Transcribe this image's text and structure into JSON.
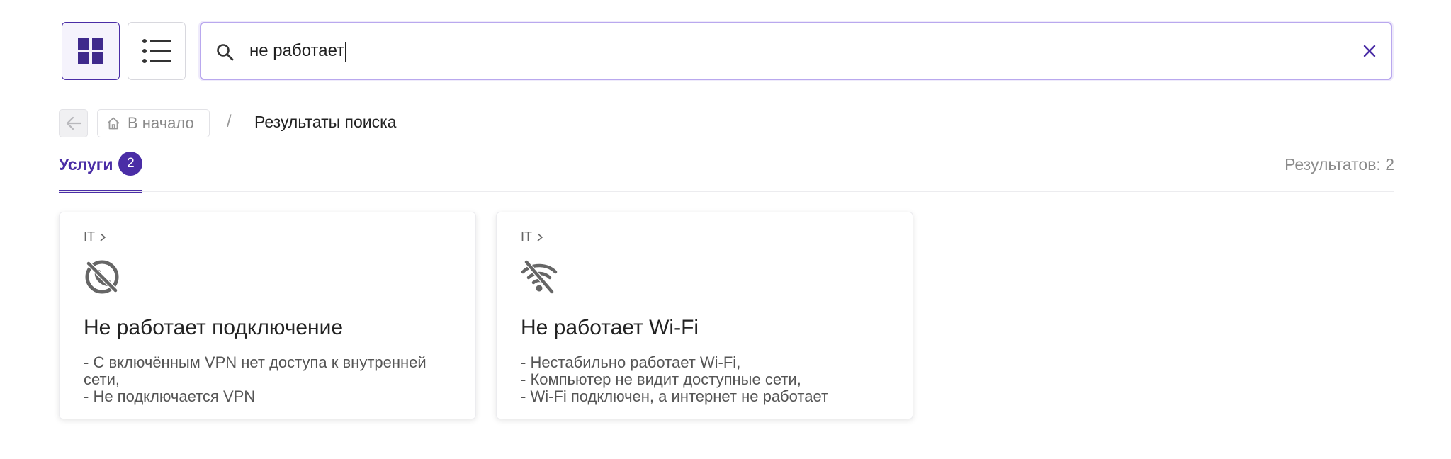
{
  "toolbar": {
    "grid_view_icon": "grid-icon",
    "list_view_icon": "list-icon",
    "active_view": "grid"
  },
  "search": {
    "value": "не работает",
    "search_icon": "search-icon",
    "clear_icon": "close-icon"
  },
  "breadcrumb": {
    "back_icon": "arrow-left-icon",
    "home_icon": "home-icon",
    "home_label": "В начало",
    "separator": "/",
    "current": "Результаты поиска"
  },
  "tabs": [
    {
      "label": "Услуги",
      "count": "2",
      "active": true
    }
  ],
  "results": {
    "count_text": "Результатов: 2"
  },
  "cards": [
    {
      "category": "IT",
      "icon": "no-connection-icon",
      "title": "Не работает подключение",
      "lines": [
        "- С включённым VPN нет доступа к внутренней сети,",
        "- Не подключается VPN"
      ]
    },
    {
      "category": "IT",
      "icon": "wifi-off-icon",
      "title": "Не работает Wi-Fi",
      "lines": [
        "- Нестабильно работает Wi-Fi,",
        "- Компьютер не видит доступные сети,",
        "- Wi-Fi подключен, а интернет не работает"
      ]
    }
  ],
  "colors": {
    "accent": "#4a2da6",
    "muted_text": "#8a8a8a"
  }
}
